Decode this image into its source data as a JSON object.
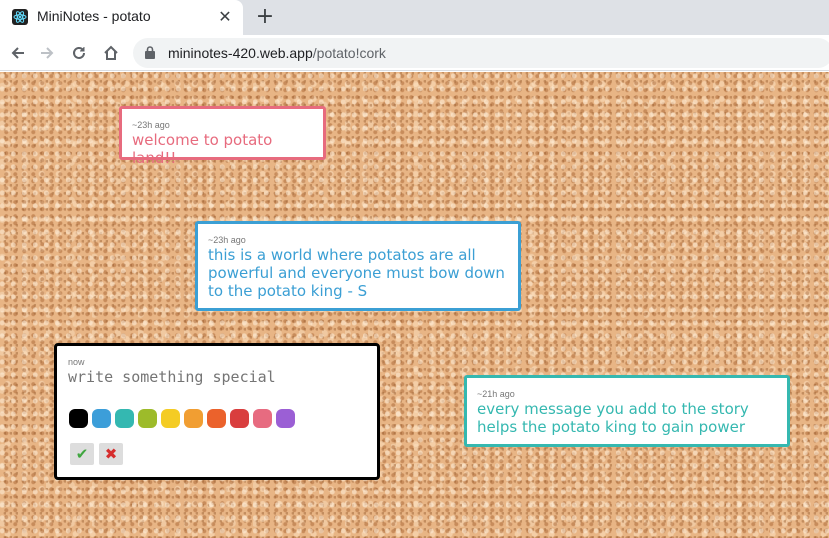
{
  "browser": {
    "tab_title": "MiniNotes - potato",
    "tab_close": "✕",
    "new_tab": "+",
    "url_host": "mininotes-420.web.app",
    "url_path": "/potato!cork"
  },
  "notes": [
    {
      "time": "~23h ago",
      "text": "welcome to potato land!!",
      "color": "#e76b7e"
    },
    {
      "time": "~23h ago",
      "text": "this is a world where potatos are all powerful and everyone must bow down to the potato king - S",
      "color": "#3b9fd4"
    },
    {
      "time": "~21h ago",
      "text": "every message you add to the story helps the potato king to gain power",
      "color": "#35b8b0"
    }
  ],
  "editor": {
    "time": "now",
    "placeholder": "write something special",
    "confirm_label": "✔",
    "cancel_label": "✖",
    "colors": [
      "#000000",
      "#3c9ed9",
      "#34b8b1",
      "#9dbb2a",
      "#f4cc24",
      "#f19e32",
      "#eb622c",
      "#d93e3e",
      "#e76b80",
      "#9b5fd5"
    ]
  }
}
